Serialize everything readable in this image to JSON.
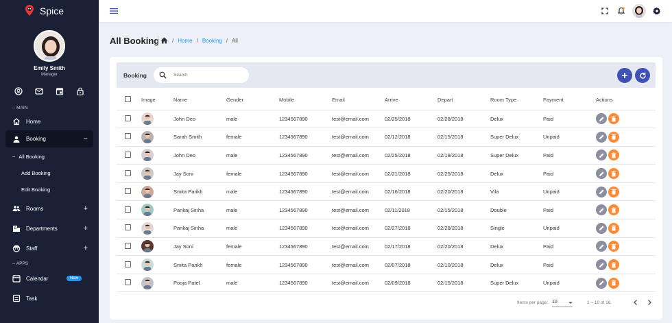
{
  "brand": {
    "name": "Spice"
  },
  "profile": {
    "name": "Emily Smith",
    "role": "Manager"
  },
  "sidebar": {
    "main_label": "-- MAIN",
    "apps_label": "-- APPS",
    "items": [
      {
        "label": "Home"
      },
      {
        "label": "Booking",
        "toggle": "−"
      },
      {
        "label": "Rooms",
        "toggle": "+"
      },
      {
        "label": "Departments",
        "toggle": "+"
      },
      {
        "label": "Staff",
        "toggle": "+"
      },
      {
        "label": "Calendar",
        "badge": "New"
      },
      {
        "label": "Task"
      }
    ],
    "booking_sub": [
      {
        "label": "All Booking",
        "prefix": "−"
      },
      {
        "label": "Add Booking"
      },
      {
        "label": "Edit Booking"
      }
    ]
  },
  "page": {
    "title": "All Booking",
    "breadcrumb": [
      "Home",
      "Booking",
      "All"
    ]
  },
  "table_card": {
    "title": "Booking",
    "search_placeholder": "Search",
    "columns": [
      "Image",
      "Name",
      "Gender",
      "Mobile",
      "Email",
      "Arrive",
      "Depart",
      "Room Type",
      "Payment",
      "Actions"
    ],
    "rows": [
      {
        "name": "John Deo",
        "gender": "male",
        "mobile": "1234567890",
        "email": "test@email.com",
        "arrive": "02/25/2018",
        "depart": "02/28/2018",
        "room": "Delux",
        "payment": "Paid",
        "avatar_color": "#e9d7cf"
      },
      {
        "name": "Sarah Smith",
        "gender": "female",
        "mobile": "1234567890",
        "email": "test@email.com",
        "arrive": "02/12/2018",
        "depart": "02/15/2018",
        "room": "Super Delux",
        "payment": "Unpaid",
        "avatar_color": "#b9b3ad"
      },
      {
        "name": "John Deo",
        "gender": "male",
        "mobile": "1234567890",
        "email": "test@email.com",
        "arrive": "02/25/2018",
        "depart": "02/18/2018",
        "room": "Super Delux",
        "payment": "Paid",
        "avatar_color": "#d8cfd0"
      },
      {
        "name": "Jay Soni",
        "gender": "female",
        "mobile": "1234567890",
        "email": "test@email.com",
        "arrive": "02/21/2018",
        "depart": "02/25/2018",
        "room": "Delux",
        "payment": "Paid",
        "avatar_color": "#cfc9c4"
      },
      {
        "name": "Smita Parikh",
        "gender": "male",
        "mobile": "1234567890",
        "email": "test@email.com",
        "arrive": "02/16/2018",
        "depart": "02/20/2018",
        "room": "Vila",
        "payment": "Unpaid",
        "avatar_color": "#c9a89a"
      },
      {
        "name": "Pankaj Sinha",
        "gender": "male",
        "mobile": "1234567890",
        "email": "test@email.com",
        "arrive": "02/11/2018",
        "depart": "02/15/2018",
        "room": "Double",
        "payment": "Paid",
        "avatar_color": "#9fc9c4"
      },
      {
        "name": "Pankaj Sinha",
        "gender": "male",
        "mobile": "1234567890",
        "email": "test@email.com",
        "arrive": "02/27/2018",
        "depart": "02/28/2018",
        "room": "Single",
        "payment": "Unpaid",
        "avatar_color": "#e2d9d6"
      },
      {
        "name": "Jay Soni",
        "gender": "female",
        "mobile": "1234567890",
        "email": "test@email.com",
        "arrive": "02/17/2018",
        "depart": "02/20/2018",
        "room": "Delux",
        "payment": "Paid",
        "avatar_color": "#5a3a2e"
      },
      {
        "name": "Smita Parikh",
        "gender": "female",
        "mobile": "1234567890",
        "email": "test@email.com",
        "arrive": "02/07/2018",
        "depart": "02/10/2018",
        "room": "Delux",
        "payment": "Paid",
        "avatar_color": "#c8dcd8"
      },
      {
        "name": "Pooja Patel",
        "gender": "male",
        "mobile": "1234567890",
        "email": "test@email.com",
        "arrive": "02/09/2018",
        "depart": "02/15/2018",
        "room": "Super Delux",
        "payment": "Unpaid",
        "avatar_color": "#bfc4cc"
      }
    ]
  },
  "pager": {
    "items_per_page_label": "Items per page:",
    "page_size": "10",
    "range": "1 – 10 of 16"
  },
  "colors": {
    "sidebar_bg": "#1a2035",
    "accent": "#3f51b5",
    "link": "#2196f3",
    "delete": "#ff8a33",
    "edit": "#8b8fa0"
  },
  "icons": {
    "quick": [
      "account-circle-icon",
      "mail-icon",
      "calendar-icon",
      "lock-icon"
    ],
    "topbar": [
      "fullscreen-icon",
      "bell-icon",
      "settings-icon"
    ]
  }
}
